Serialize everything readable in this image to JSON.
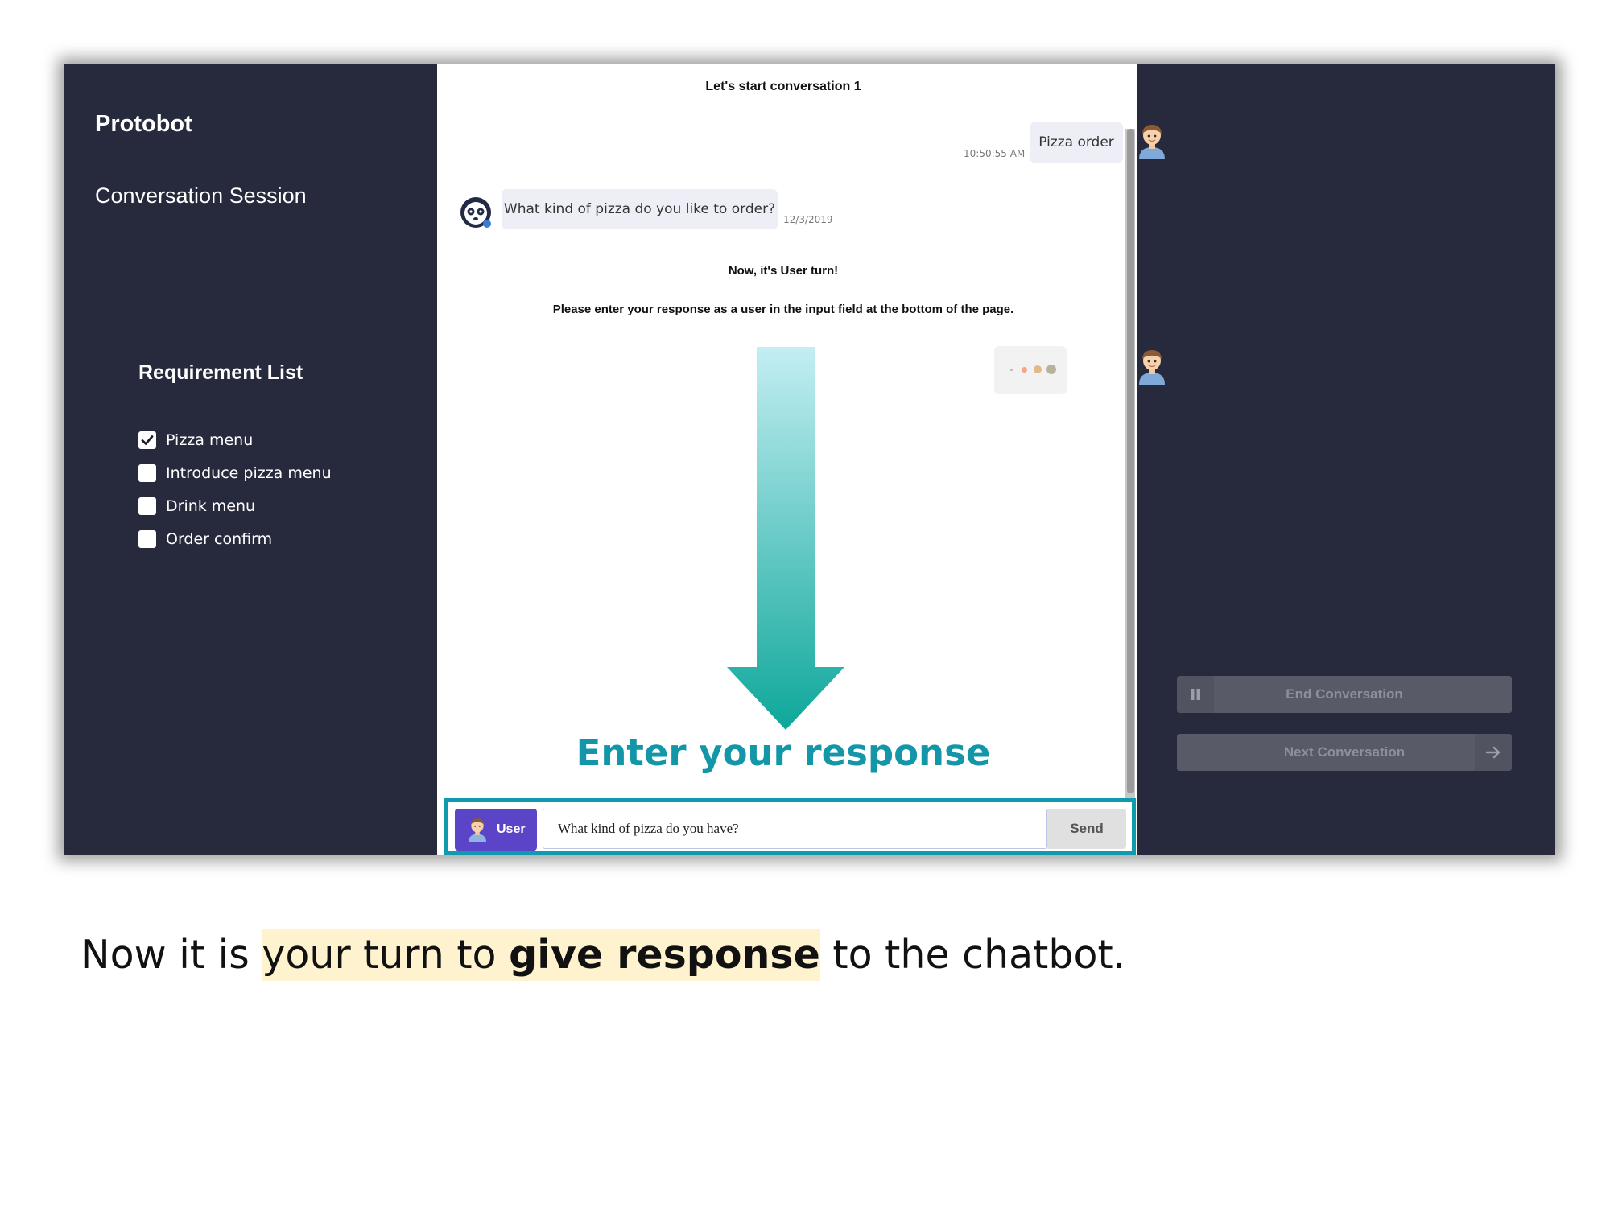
{
  "app": {
    "name": "Protobot",
    "section": "Conversation Session"
  },
  "requirements": {
    "title": "Requirement List",
    "items": [
      {
        "label": "Pizza menu",
        "checked": true
      },
      {
        "label": "Introduce pizza menu",
        "checked": false
      },
      {
        "label": "Drink menu",
        "checked": false
      },
      {
        "label": "Order confirm",
        "checked": false
      }
    ]
  },
  "chat": {
    "title": "Let's start conversation 1",
    "messages": [
      {
        "sender": "user",
        "text": "Pizza order",
        "time": "10:50:55 AM"
      },
      {
        "sender": "bot",
        "text": "What kind of pizza do you like to order?",
        "time": "12/3/2019"
      }
    ],
    "turn_title": "Now, it's User turn!",
    "turn_message": "Please enter your response as a user in the input field at the bottom of the page.",
    "typing_indicator": true,
    "overlay_label": "Enter your response",
    "colors": {
      "arrow_top": "#c4eef3",
      "arrow_bottom": "#0ea79a",
      "highlight": "#109aae"
    }
  },
  "input_bar": {
    "role_label": "User",
    "value": "What kind of pizza do you have?",
    "send_label": "Send"
  },
  "controls": {
    "end_label": "End Conversation",
    "next_label": "Next Conversation",
    "end_icon": "pause-icon",
    "next_icon": "arrow-right-icon"
  },
  "caption": {
    "part1": "Now it is ",
    "part2": "your turn to ",
    "part3": "give response",
    "part4": " to the chatbot."
  }
}
